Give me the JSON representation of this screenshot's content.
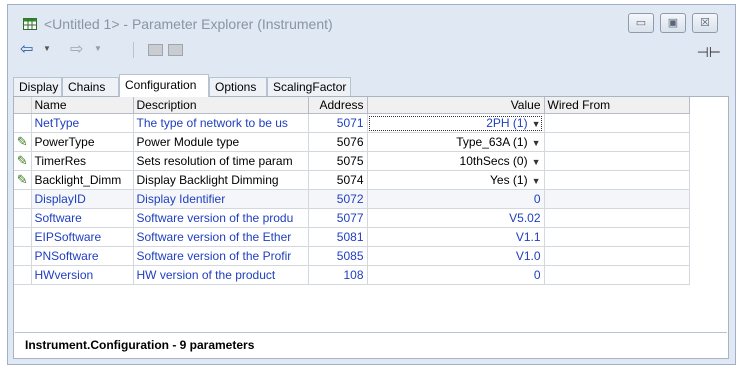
{
  "window": {
    "title": "<Untitled 1> - Parameter Explorer (Instrument)",
    "controls": {
      "minimize": "▭",
      "maximize": "▣",
      "close": "☒"
    }
  },
  "toolbar": {
    "back_icon": "back-arrow-icon",
    "forward_icon": "forward-arrow-icon",
    "pin": "⊣⊢"
  },
  "tabs": [
    {
      "label": "Display"
    },
    {
      "label": "Chains"
    },
    {
      "label": "Configuration",
      "active": true
    },
    {
      "label": "Options"
    },
    {
      "label": "ScalingFactor"
    }
  ],
  "table": {
    "columns": [
      "Name",
      "Description",
      "Address",
      "Value",
      "Wired From"
    ],
    "rows": [
      {
        "name": "NetType",
        "description": "The type of network to be us",
        "address": "5071",
        "value": "2PH (1)",
        "dropdown": true,
        "blue": true,
        "pencil": false
      },
      {
        "name": "PowerType",
        "description": "Power Module type",
        "address": "5076",
        "value": "Type_63A (1)",
        "dropdown": true,
        "blue": false,
        "pencil": true
      },
      {
        "name": "TimerRes",
        "description": "Sets resolution of time param",
        "address": "5075",
        "value": "10thSecs (0)",
        "dropdown": true,
        "blue": false,
        "pencil": true
      },
      {
        "name": "Backlight_Dimm",
        "description": "Display Backlight Dimming",
        "address": "5074",
        "value": "Yes (1)",
        "dropdown": true,
        "blue": false,
        "pencil": true
      },
      {
        "name": "DisplayID",
        "description": "Display Identifier",
        "address": "5072",
        "value": "0",
        "dropdown": false,
        "blue": true,
        "pencil": false,
        "selected": true
      },
      {
        "name": "Software",
        "description": "Software version of the produ",
        "address": "5077",
        "value": "V5.02",
        "dropdown": false,
        "blue": true,
        "pencil": false
      },
      {
        "name": "EIPSoftware",
        "description": "Software version of the Ether",
        "address": "5081",
        "value": "V1.1",
        "dropdown": false,
        "blue": true,
        "pencil": false
      },
      {
        "name": "PNSoftware",
        "description": "Software version of the Profir",
        "address": "5085",
        "value": "V1.0",
        "dropdown": false,
        "blue": true,
        "pencil": false
      },
      {
        "name": "HWversion",
        "description": "HW version of the product",
        "address": "108",
        "value": "0",
        "dropdown": false,
        "blue": true,
        "pencil": false
      }
    ]
  },
  "status": {
    "text": "Instrument.Configuration  -  9 parameters"
  }
}
